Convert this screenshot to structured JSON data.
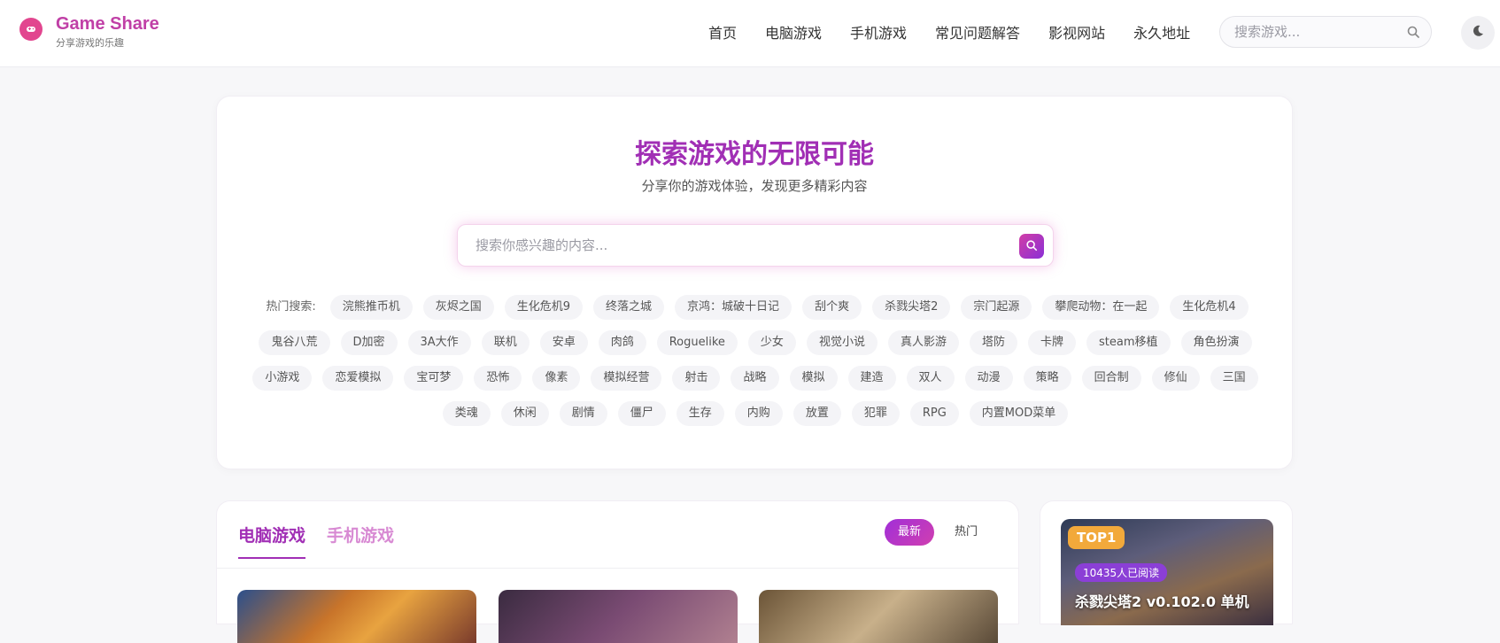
{
  "header": {
    "brand_title": "Game Share",
    "brand_subtitle": "分享游戏的乐趣",
    "nav": [
      "首页",
      "电脑游戏",
      "手机游戏",
      "常见问题解答",
      "影视网站",
      "永久地址"
    ],
    "search_placeholder": "搜索游戏...",
    "logo_icon": "game-controller-icon",
    "search_icon": "search-icon",
    "theme_icon": "moon-icon"
  },
  "hero": {
    "title": "探索游戏的无限可能",
    "subtitle": "分享你的游戏体验，发现更多精彩内容",
    "search_placeholder": "搜索你感兴趣的内容...",
    "hot_label": "热门搜索:",
    "tags": [
      "浣熊推币机",
      "灰烬之国",
      "生化危机9",
      "终落之城",
      "京鸿：城破十日记",
      "刮个爽",
      "杀戮尖塔2",
      "宗门起源",
      "攀爬动物：在一起",
      "生化危机4",
      "鬼谷八荒",
      "D加密",
      "3A大作",
      "联机",
      "安卓",
      "肉鸽",
      "Roguelike",
      "少女",
      "视觉小说",
      "真人影游",
      "塔防",
      "卡牌",
      "steam移植",
      "角色扮演",
      "小游戏",
      "恋爱模拟",
      "宝可梦",
      "恐怖",
      "像素",
      "模拟经营",
      "射击",
      "战略",
      "模拟",
      "建造",
      "双人",
      "动漫",
      "策略",
      "回合制",
      "修仙",
      "三国",
      "类魂",
      "休闲",
      "剧情",
      "僵尸",
      "生存",
      "内购",
      "放置",
      "犯罪",
      "RPG",
      "内置MOD菜单"
    ]
  },
  "content": {
    "tabs": [
      "电脑游戏",
      "手机游戏"
    ],
    "sort": [
      "最新",
      "热门"
    ]
  },
  "sidebar": {
    "top_badge": "TOP1",
    "reads": "10435人已阅读",
    "title": "杀戮尖塔2 v0.102.0 单机"
  },
  "colors": {
    "brand": "#c03fa6",
    "accent": "#a12fb5",
    "badge_gold": "#f2a93b"
  }
}
